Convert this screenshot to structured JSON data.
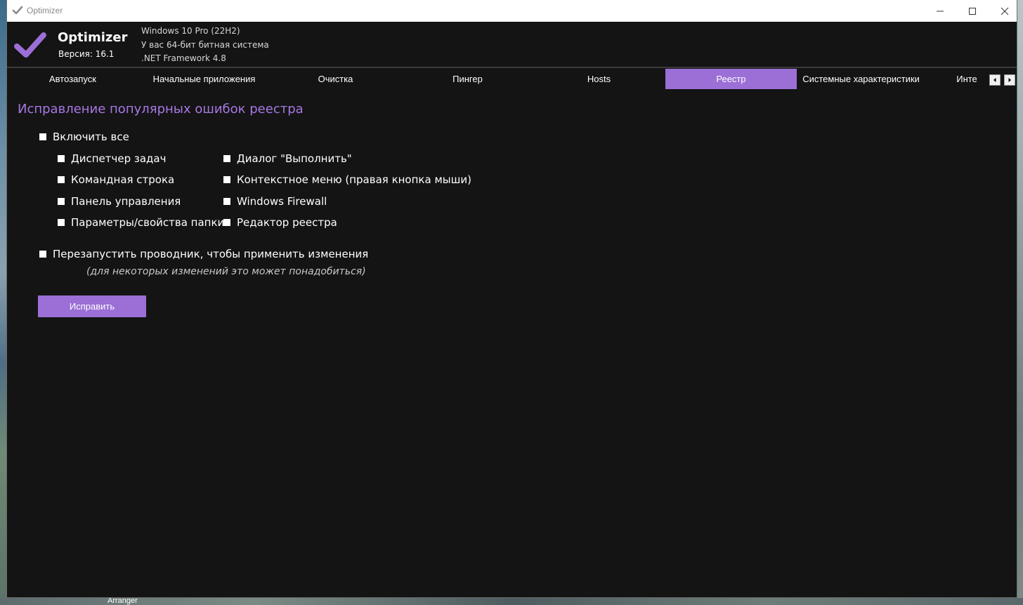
{
  "window": {
    "title": "Optimizer",
    "controls": {
      "minimize": "—",
      "maximize": "☐",
      "close": "✕"
    }
  },
  "header": {
    "app_name": "Optimizer",
    "version": "Версия: 16.1",
    "system_lines": [
      "Windows 10 Pro (22H2)",
      "У вас 64-бит битная система",
      ".NET Framework 4.8"
    ]
  },
  "tabs": [
    {
      "label": "Автозапуск",
      "active": false
    },
    {
      "label": "Начальные приложения",
      "active": false
    },
    {
      "label": "Очистка",
      "active": false
    },
    {
      "label": "Пингер",
      "active": false
    },
    {
      "label": "Hosts",
      "active": false
    },
    {
      "label": "Реестр",
      "active": true
    },
    {
      "label": "Системные характеристики",
      "active": false
    },
    {
      "label": "Инте",
      "active": false
    }
  ],
  "tab_scroll": {
    "left": "◂",
    "right": "▸"
  },
  "registry": {
    "title": "Исправление популярных ошибок реестра",
    "enable_all": {
      "label": "Включить все",
      "checked": false
    },
    "options_left": [
      {
        "label": "Диспетчер задач",
        "checked": false
      },
      {
        "label": "Командная строка",
        "checked": false
      },
      {
        "label": "Панель управления",
        "checked": false
      },
      {
        "label": "Параметры/свойства папки",
        "checked": false
      }
    ],
    "options_right": [
      {
        "label": "Диалог \"Выполнить\"",
        "checked": false
      },
      {
        "label": "Контекстное меню (правая кнопка мыши)",
        "checked": false
      },
      {
        "label": "Windows Firewall",
        "checked": false
      },
      {
        "label": "Редактор реестра",
        "checked": false
      }
    ],
    "restart_explorer": {
      "label": "Перезапустить проводник, чтобы применить изменения",
      "checked": false
    },
    "hint": "(для некоторых изменений это может понадобиться)",
    "fix_button": "Исправить"
  },
  "desktop": {
    "taskbar_label": "Arranger"
  },
  "colors": {
    "accent": "#9b6fd6",
    "title_accent": "#a778e4",
    "background": "#141414",
    "text": "#ffffff"
  },
  "icons": {
    "app": "checkmark-icon",
    "minimize": "minimize-icon",
    "maximize": "maximize-icon",
    "close": "close-icon"
  }
}
